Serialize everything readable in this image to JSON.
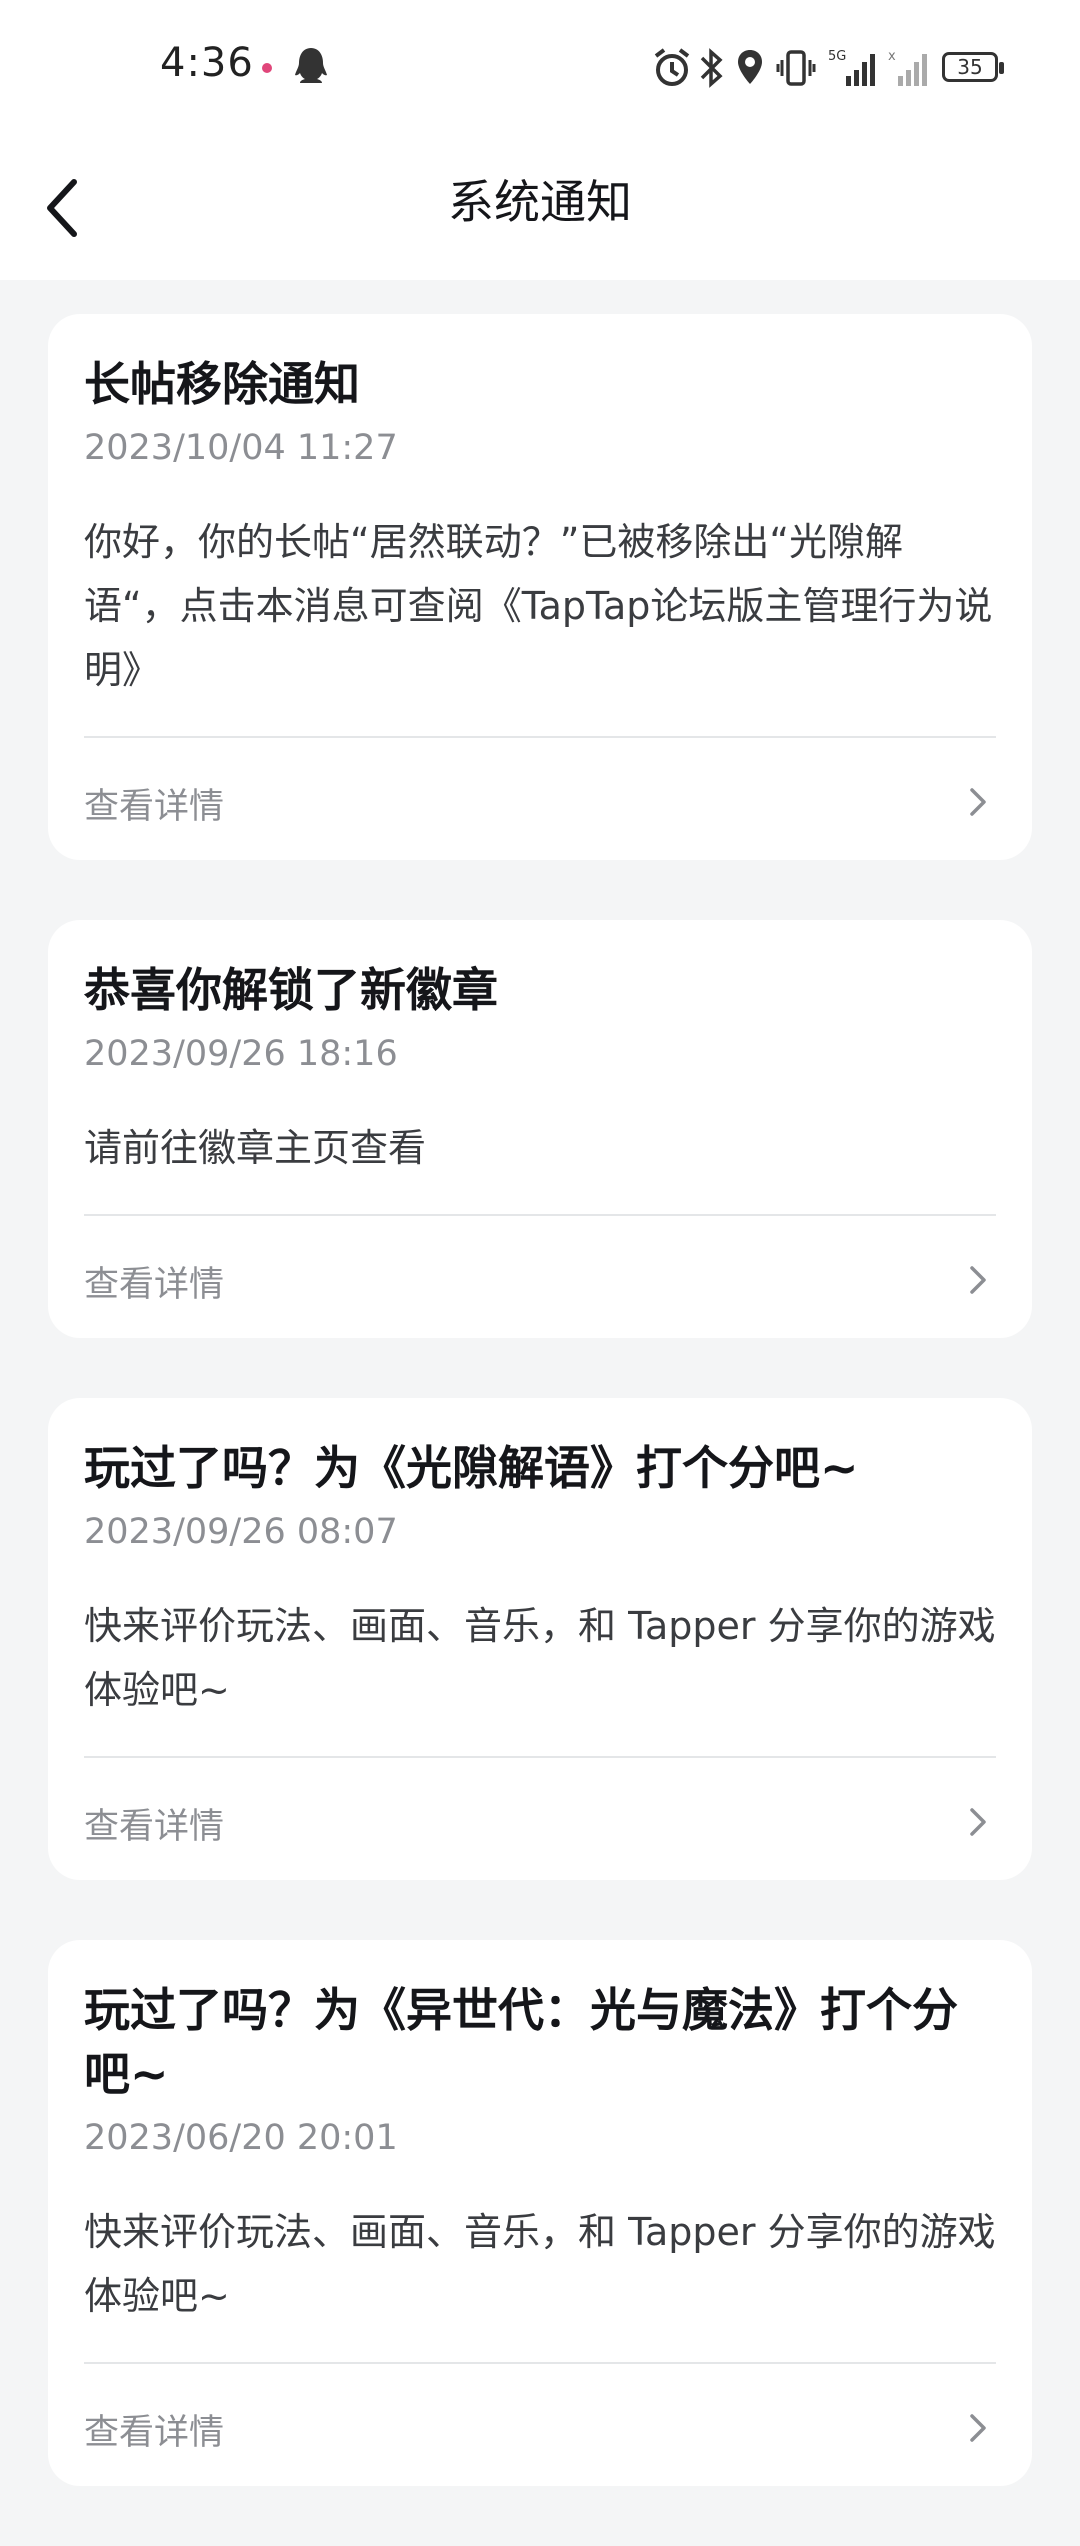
{
  "status_bar": {
    "time": "4:36",
    "battery": "35",
    "icons": [
      "qq-icon",
      "alarm-icon",
      "bluetooth-icon",
      "location-icon",
      "vibrate-icon",
      "signal-5g-icon",
      "signal-icon",
      "battery-icon"
    ]
  },
  "header": {
    "title": "系统通知",
    "back_icon": "chevron-left-icon"
  },
  "notifications": [
    {
      "title": "长帖移除通知",
      "time": "2023/10/04 11:27",
      "body": "你好，你的长帖“居然联动？”已被移除出“光隙解语“，点击本消息可查阅《TapTap论坛版主管理行为说明》",
      "action": "查看详情"
    },
    {
      "title": "恭喜你解锁了新徽章",
      "time": "2023/09/26 18:16",
      "body": "请前往徽章主页查看",
      "action": "查看详情"
    },
    {
      "title": "玩过了吗？为《光隙解语》打个分吧~",
      "time": "2023/09/26 08:07",
      "body": "快来评价玩法、画面、音乐，和 Tapper 分享你的游戏体验吧~",
      "action": "查看详情"
    },
    {
      "title": "玩过了吗？为《异世代：光与魔法》打个分吧~",
      "time": "2023/06/20 20:01",
      "body": "快来评价玩法、画面、音乐，和 Tapper 分享你的游戏体验吧~",
      "action": "查看详情"
    }
  ],
  "colors": {
    "background": "#f4f5f6",
    "card": "#ffffff",
    "title_text": "#15161a",
    "secondary_text": "#8c8e93"
  }
}
